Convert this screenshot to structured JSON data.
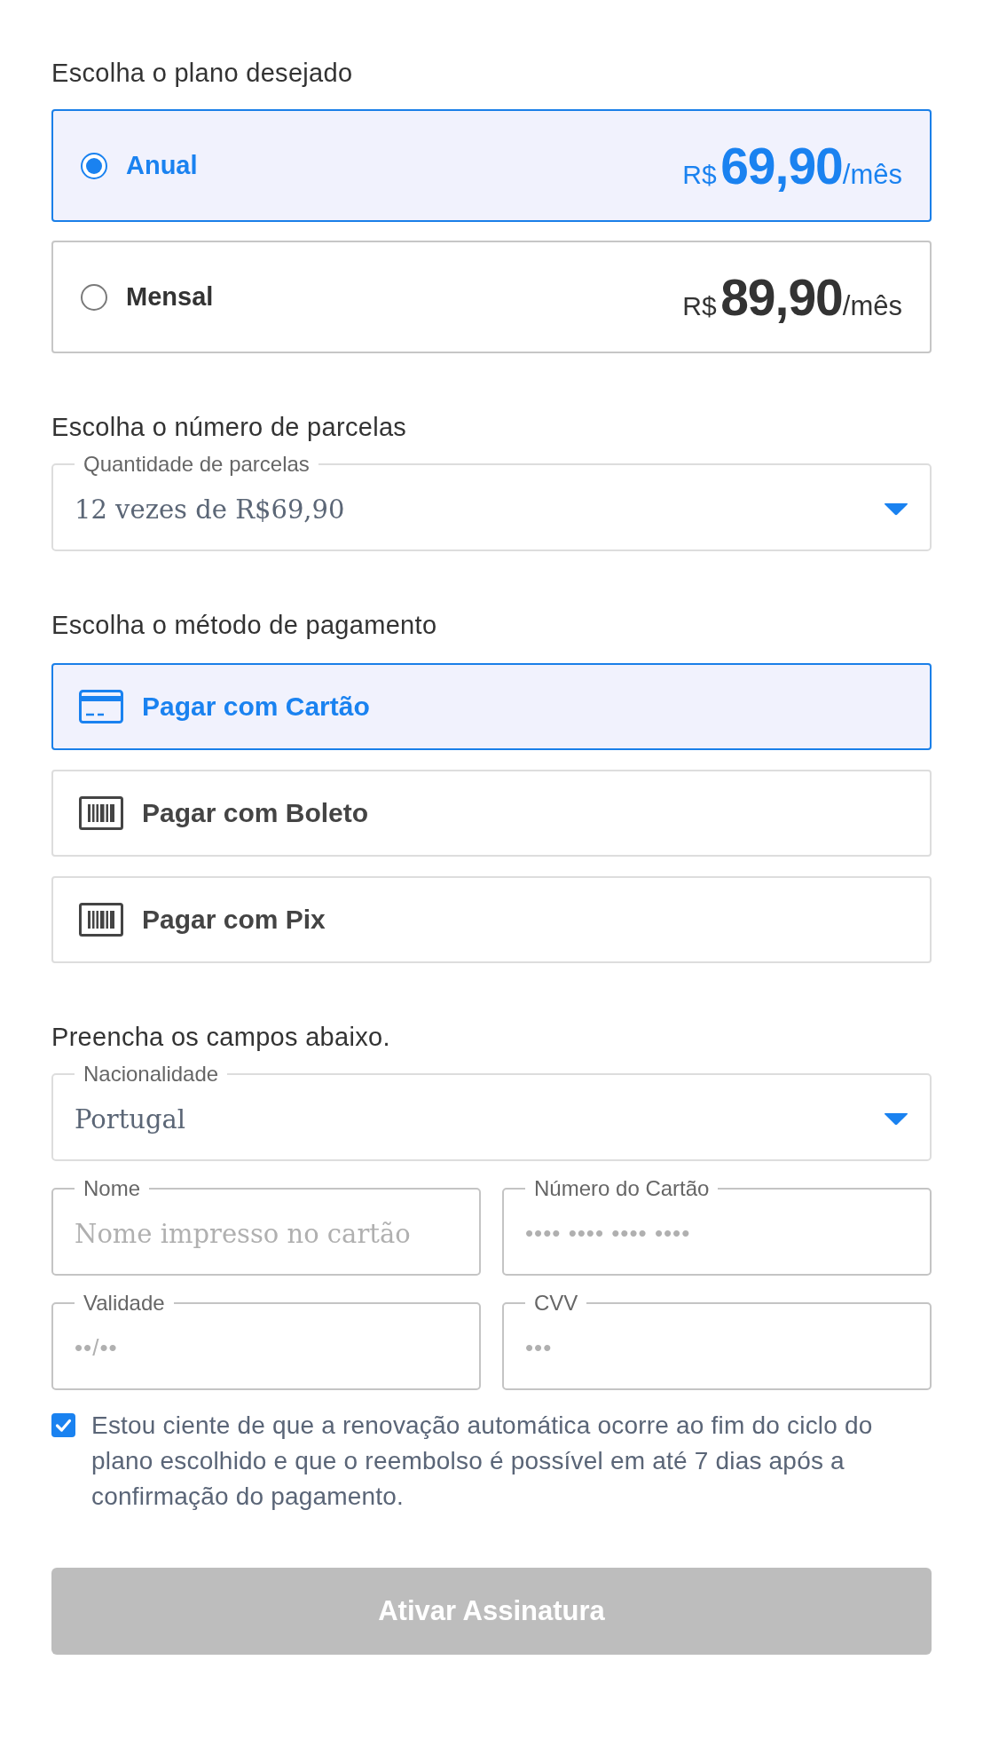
{
  "plan_section": {
    "heading": "Escolha o plano desejado",
    "plans": [
      {
        "name": "Anual",
        "currency": "R$",
        "amount": "69,90",
        "period": "/mês",
        "selected": true
      },
      {
        "name": "Mensal",
        "currency": "R$",
        "amount": "89,90",
        "period": "/mês",
        "selected": false
      }
    ]
  },
  "installments_section": {
    "heading": "Escolha o número de parcelas",
    "select": {
      "label": "Quantidade de parcelas",
      "value": "12 vezes de R$69,90"
    }
  },
  "payment_section": {
    "heading": "Escolha o método de pagamento",
    "methods": [
      {
        "label": "Pagar com Cartão",
        "kind": "card",
        "selected": true
      },
      {
        "label": "Pagar com Boleto",
        "kind": "barcode",
        "selected": false
      },
      {
        "label": "Pagar com Pix",
        "kind": "barcode",
        "selected": false
      }
    ]
  },
  "form_section": {
    "heading": "Preencha os campos abaixo.",
    "nationality": {
      "label": "Nacionalidade",
      "value": "Portugal"
    },
    "fields": [
      {
        "label": "Nome",
        "placeholder": "Nome impresso no cartão",
        "kind": "text"
      },
      {
        "label": "Número do Cartão",
        "placeholder": "•••• •••• •••• ••••",
        "kind": "masked"
      },
      {
        "label": "Validade",
        "placeholder": "••/••",
        "kind": "masked"
      },
      {
        "label": "CVV",
        "placeholder": "•••",
        "kind": "masked"
      }
    ]
  },
  "consent": {
    "checked": true,
    "text": "Estou ciente de que a renovação automática ocorre ao fim do ciclo do plano escolhido e que o reembolso é possível em até 7 dias após a confirmação do pagamento."
  },
  "submit_button": {
    "label": "Ativar Assinatura",
    "disabled": true
  }
}
